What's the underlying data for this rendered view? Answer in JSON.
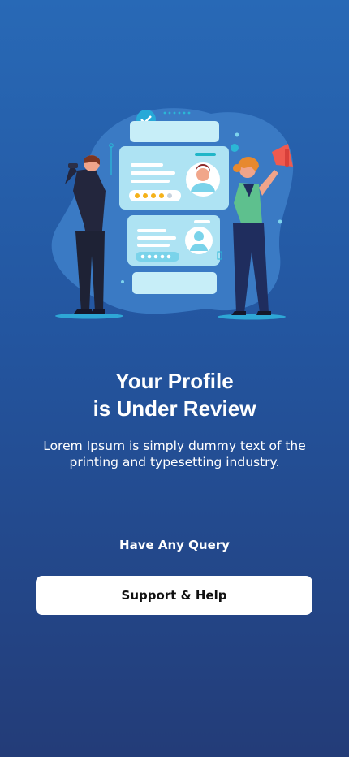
{
  "screen": {
    "title_line1": "Your Profile",
    "title_line2": "is Under Review",
    "description": "Lorem Ipsum is simply dummy text of the printing and typesetting industry.",
    "query_label": "Have Any Query",
    "support_button_label": "Support & Help"
  },
  "colors": {
    "background_top": "#2869b6",
    "background_bottom": "#233c78",
    "button_bg": "#ffffff",
    "card_bg": "#aee3f3",
    "accent_teal": "#20b6c8",
    "star": "#f5b21a"
  },
  "illustration": {
    "icon": "profile-review-illustration-icon",
    "rating_stars": "4 of 5"
  }
}
